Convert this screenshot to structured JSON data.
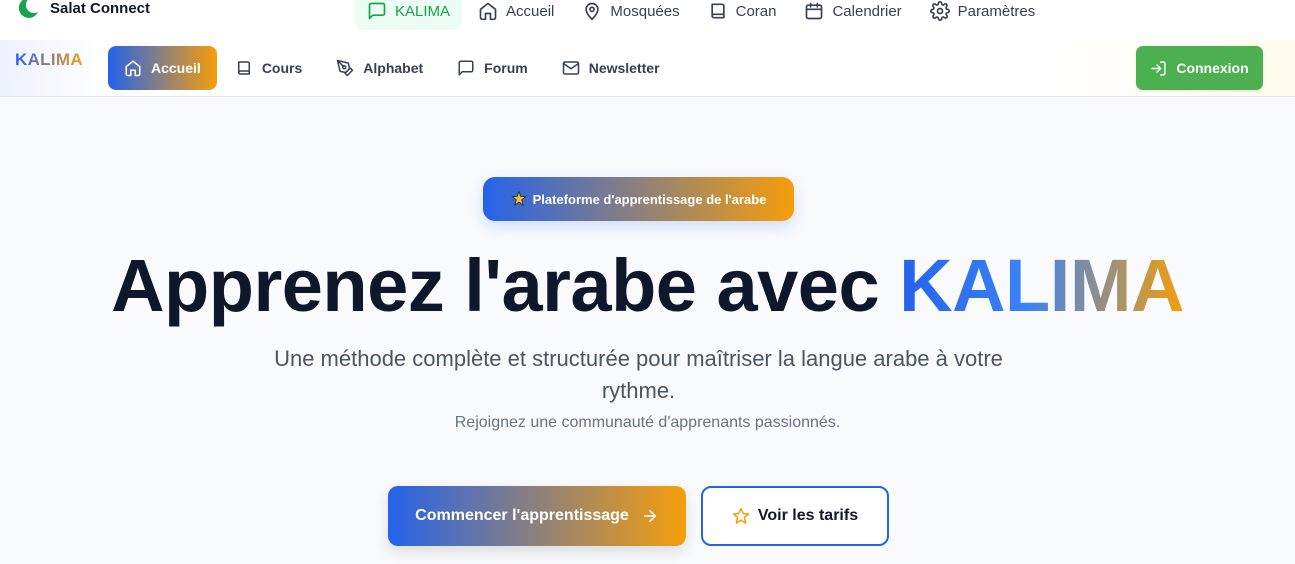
{
  "topbar": {
    "brand": "Salat Connect",
    "nav": [
      {
        "label": "KALIMA",
        "icon": "chat-icon",
        "active": true
      },
      {
        "label": "Accueil",
        "icon": "home-icon"
      },
      {
        "label": "Mosquées",
        "icon": "map-pin-icon"
      },
      {
        "label": "Coran",
        "icon": "book-icon"
      },
      {
        "label": "Calendrier",
        "icon": "calendar-icon"
      },
      {
        "label": "Paramètres",
        "icon": "gear-icon"
      }
    ]
  },
  "subnav": {
    "logo": "KALIMA",
    "items": [
      {
        "label": "Accueil",
        "icon": "home-icon",
        "active": true
      },
      {
        "label": "Cours",
        "icon": "book-icon"
      },
      {
        "label": "Alphabet",
        "icon": "pen-icon"
      },
      {
        "label": "Forum",
        "icon": "chat-icon"
      },
      {
        "label": "Newsletter",
        "icon": "mail-icon"
      }
    ],
    "login": "Connexion"
  },
  "hero": {
    "badge": "Plateforme d'apprentissage de l'arabe",
    "title_prefix": "Apprenez l'arabe avec ",
    "title_accent": "KALIMA",
    "subtitle": "Une méthode complète et structurée pour maîtriser la langue arabe à votre rythme.",
    "subtext": "Rejoignez une communauté d'apprenants passionnés.",
    "cta_primary": "Commencer l'apprentissage",
    "cta_secondary": "Voir les tarifs"
  },
  "colors": {
    "accent_blue": "#2563eb",
    "accent_orange": "#f59e0b",
    "success_green": "#4caf50"
  }
}
